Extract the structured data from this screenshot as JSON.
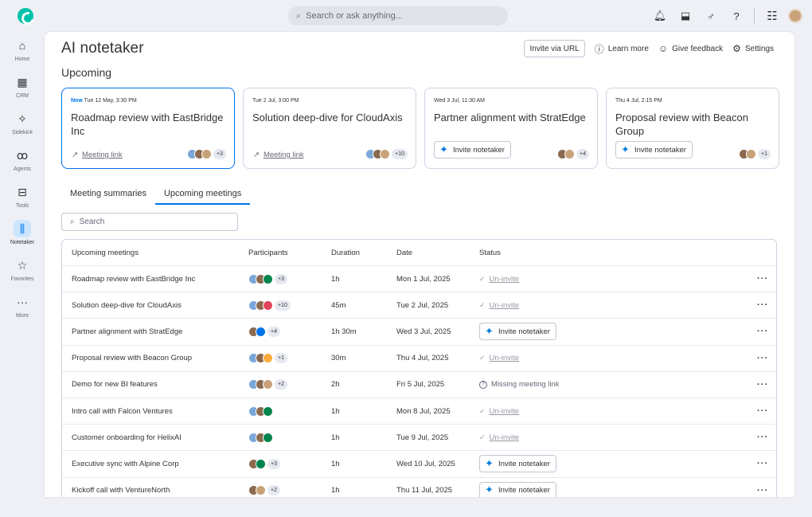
{
  "topbar": {
    "search_placeholder": "Search or ask anything..."
  },
  "rail": [
    {
      "label": "Home",
      "icon": "home-icon",
      "glyph": "⌂"
    },
    {
      "label": "CRM",
      "icon": "grid-icon",
      "glyph": "▦"
    },
    {
      "label": "Sidekick",
      "icon": "sparkle-icon",
      "glyph": "✧"
    },
    {
      "label": "Agents",
      "icon": "agents-icon",
      "glyph": "ꝏ"
    },
    {
      "label": "Tools",
      "icon": "toolbox-icon",
      "glyph": "⊟"
    },
    {
      "label": "Notetaker",
      "icon": "waveform-icon",
      "glyph": "⫼"
    },
    {
      "label": "Favorites",
      "icon": "star-icon",
      "glyph": "☆"
    },
    {
      "label": "More",
      "icon": "more-icon",
      "glyph": "···"
    }
  ],
  "header": {
    "title": "AI notetaker",
    "invite_url": "Invite via URL",
    "learn_more": "Learn more",
    "give_feedback": "Give feedback",
    "settings": "Settings"
  },
  "upcoming_heading": "Upcoming",
  "cards": [
    {
      "now": "Now",
      "date": "Tue 12 May, 3:30 PM",
      "title": "Roadmap review with EastBridge Inc",
      "link": "Meeting link",
      "more": "+3"
    },
    {
      "now": "",
      "date": "Tue 2 Jul, 3:00 PM",
      "title": "Solution deep-dive for CloudAxis",
      "link": "Meeting link",
      "more": "+10"
    },
    {
      "now": "",
      "date": "Wed 3 Jul, 11:30 AM",
      "title": "Partner alignment with StratEdge",
      "invite": "Invite notetaker",
      "more": "+4"
    },
    {
      "now": "",
      "date": "Thu 4 Jul, 2:15 PM",
      "title": "Proposal review with Beacon Group",
      "invite": "Invite notetaker",
      "more": "+1"
    }
  ],
  "tabs": [
    "Meeting summaries",
    "Upcoming meetings"
  ],
  "table_search": "Search",
  "table": {
    "headers": [
      "Upcoming meetings",
      "Participants",
      "Duration",
      "Date",
      "Status"
    ],
    "rows": [
      {
        "name": "Roadmap review with EastBridge Inc",
        "more": "+3",
        "duration": "1h",
        "date": "Mon 1 Jul, 2025",
        "status": "Un-invite",
        "kind": "uninvite",
        "avs": [
          "#7aa7d8",
          "#8a6a50",
          "#00854d"
        ]
      },
      {
        "name": "Solution deep-dive for CloudAxis",
        "more": "+10",
        "duration": "45m",
        "date": "Tue 2 Jul, 2025",
        "status": "Un-invite",
        "kind": "uninvite",
        "avs": [
          "#7aa7d8",
          "#8a6a50",
          "#e2445c"
        ]
      },
      {
        "name": "Partner alignment with StratEdge",
        "more": "+4",
        "duration": "1h 30m",
        "date": "Wed 3 Jul, 2025",
        "status": "Invite notetaker",
        "kind": "invite",
        "avs": [
          "#8a6a50",
          "#0073ea"
        ]
      },
      {
        "name": "Proposal review with Beacon Group",
        "more": "+1",
        "duration": "30m",
        "date": "Thu 4 Jul, 2025",
        "status": "Un-invite",
        "kind": "uninvite",
        "avs": [
          "#7aa7d8",
          "#8a6a50",
          "#fdab3d"
        ]
      },
      {
        "name": "Demo for new BI features",
        "more": "+2",
        "duration": "2h",
        "date": "Fri 5 Jul, 2025",
        "status": "Missing meeting link",
        "kind": "missing",
        "avs": [
          "#7aa7d8",
          "#8a6a50",
          "#c9a27a"
        ]
      },
      {
        "name": "Intro call with Falcon Ventures",
        "more": "",
        "duration": "1h",
        "date": "Mon 8 Jul, 2025",
        "status": "Un-invite",
        "kind": "uninvite",
        "avs": [
          "#7aa7d8",
          "#8a6a50",
          "#00854d"
        ]
      },
      {
        "name": "Customer onboarding for HelixAI",
        "more": "",
        "duration": "1h",
        "date": "Tue 9 Jul, 2025",
        "status": "Un-invite",
        "kind": "uninvite",
        "avs": [
          "#7aa7d8",
          "#8a6a50",
          "#00854d"
        ]
      },
      {
        "name": "Executive sync with Alpine Corp",
        "more": "+3",
        "duration": "1h",
        "date": "Wed 10 Jul, 2025",
        "status": "Invite notetaker",
        "kind": "invite",
        "avs": [
          "#8a6a50",
          "#00854d"
        ]
      },
      {
        "name": "Kickoff call with VentureNorth",
        "more": "+2",
        "duration": "1h",
        "date": "Thu 11 Jul, 2025",
        "status": "Invite notetaker",
        "kind": "invite",
        "avs": [
          "#8a6a50",
          "#c9a27a"
        ]
      }
    ]
  },
  "row_menu_glyph": "···"
}
